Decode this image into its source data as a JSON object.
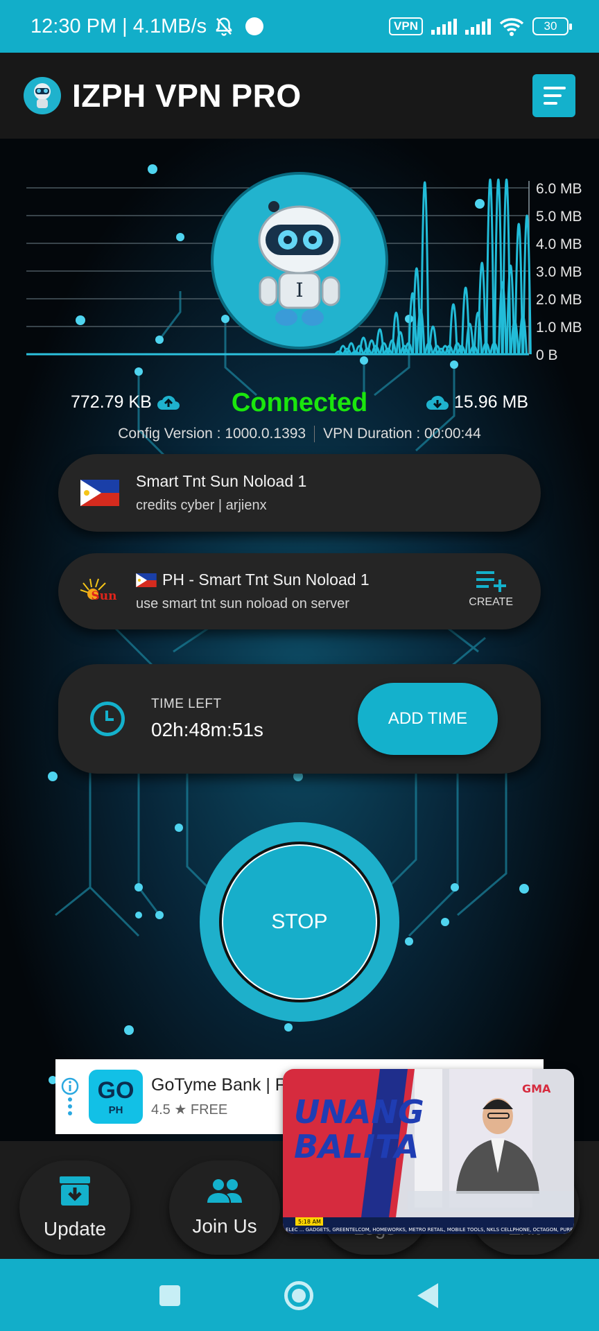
{
  "status_bar": {
    "time_speed": "12:30 PM | 4.1MB/s",
    "vpn_badge": "VPN",
    "battery": "30"
  },
  "app_bar": {
    "title": "IZPH VPN PRO",
    "menu_icon": "hamburger-menu-icon"
  },
  "colors": {
    "accent": "#14b1cc",
    "connected": "#1be60d",
    "card": "#252525",
    "appbar": "#181818"
  },
  "chart_data": {
    "type": "bar",
    "y_tick_labels": [
      "6.0 MB",
      "5.0 MB",
      "4.0 MB",
      "3.0 MB",
      "2.0 MB",
      "1.0 MB",
      "0 B"
    ],
    "ylim": [
      0,
      6.0
    ],
    "unit": "MB",
    "grid": true,
    "series": [
      {
        "values": [
          0,
          0,
          0,
          0,
          0,
          0,
          0,
          0,
          0,
          0,
          0,
          0,
          0,
          0,
          0,
          0,
          0,
          0,
          0,
          0,
          0,
          0,
          0,
          0,
          0,
          0,
          0,
          0,
          0,
          0,
          0,
          0,
          0,
          0,
          0,
          0,
          0,
          0,
          0,
          0,
          0,
          0,
          0,
          0,
          0,
          0,
          0,
          0,
          0,
          0,
          0,
          0,
          0,
          0,
          0,
          0,
          0,
          0,
          0,
          0,
          0,
          0,
          0,
          0,
          0,
          0,
          0,
          0,
          0,
          0,
          0,
          0,
          0,
          0,
          0,
          0,
          0.1,
          0.3,
          0.2,
          0.4,
          0.1,
          0.3,
          0.6,
          0.2,
          0.5,
          0.3,
          0.9,
          0.4,
          0.2,
          0.5,
          1.5,
          0.8,
          0.3,
          0.4,
          2.2,
          3.1,
          1.6,
          6.2,
          0.4,
          1.0,
          0.3,
          0.2,
          0.3,
          0.3,
          1.8,
          0.4,
          0.3,
          2.4,
          1.1,
          0.3,
          1.5,
          3.3,
          0.4,
          6.3,
          0.4,
          6.3,
          2.6,
          6.3,
          3.2,
          1.2,
          4.7,
          1.4,
          5.0
        ]
      }
    ]
  },
  "connection": {
    "upload": "772.79 KB",
    "download": "15.96 MB",
    "status": "Connected",
    "config_version": "Config Version : 1000.0.1393",
    "vpn_duration": "VPN Duration : 00:00:44"
  },
  "server_card": {
    "title": "Smart Tnt Sun Noload 1",
    "subtitle": "credits cyber | arjienx"
  },
  "network_card": {
    "logo_text": "Sun",
    "title": "PH - Smart Tnt Sun Noload 1",
    "subtitle": "use smart tnt sun noload on server",
    "create_label": "CREATE"
  },
  "timer_card": {
    "label": "TIME LEFT",
    "value": "02h:48m:51s",
    "add_time_label": "ADD TIME"
  },
  "stop_button": {
    "label": "STOP"
  },
  "ad": {
    "logo_top": "GO",
    "logo_bottom": "PH",
    "title": "GoTyme Bank | F",
    "rating": "4.5 ★ FREE"
  },
  "bottom_nav": {
    "items": [
      {
        "label": "Update",
        "icon": "archive-download-icon"
      },
      {
        "label": "Join Us",
        "icon": "people-icon"
      },
      {
        "label": "Logs",
        "icon": "logs-icon"
      },
      {
        "label": "Exit",
        "icon": "exit-icon"
      }
    ]
  },
  "video_overlay": {
    "show_title_line1": "UNANG",
    "show_title_line2": "BALITA",
    "channel": "GMA",
    "ticker_time": "5:18 AM",
    "ticker_text": "ELEC ... GADGETS, GREENTELCOM, HOMEWORKS, METRO RETAIL, MOBILE TOOLS, NKLS CELLPHONE, OCTAGON, PUREGOLD"
  }
}
